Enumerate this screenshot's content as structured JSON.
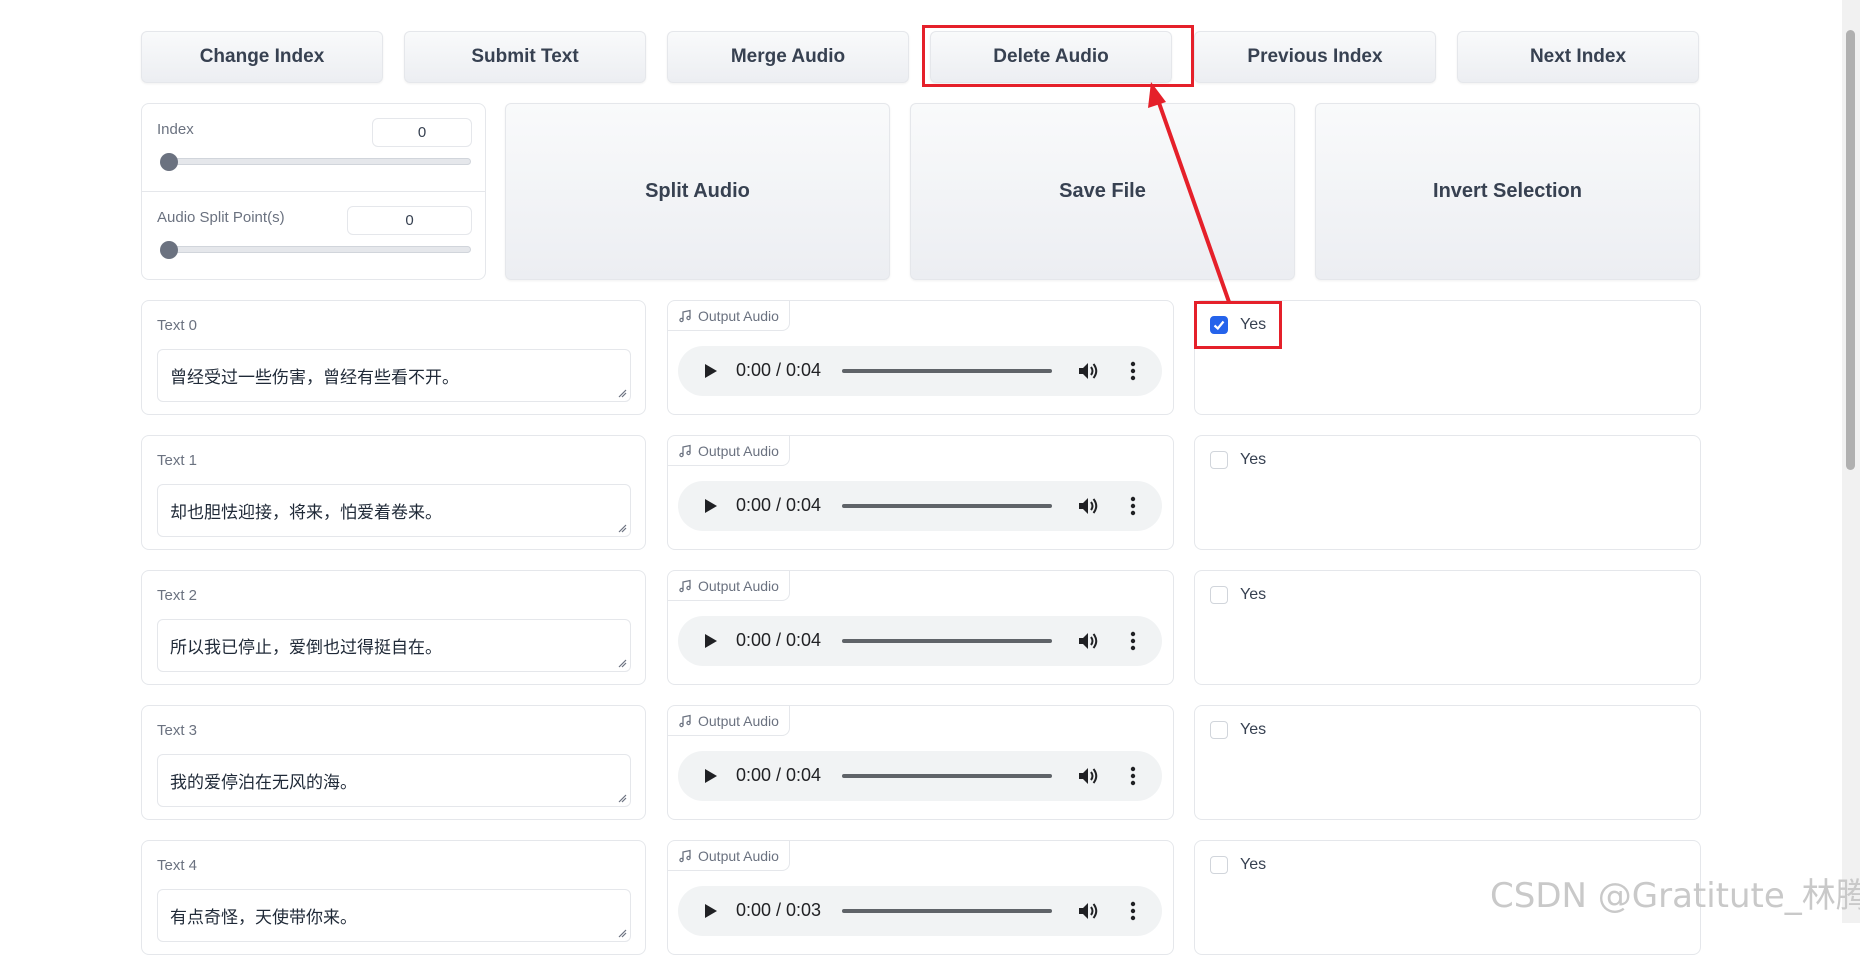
{
  "toolbar": {
    "buttons": [
      "Change Index",
      "Submit Text",
      "Merge Audio",
      "Delete Audio",
      "Previous Index",
      "Next Index"
    ]
  },
  "controls": {
    "index_label": "Index",
    "index_value": "0",
    "index_slider_fraction": 0,
    "split_label": "Audio Split Point(s)",
    "split_value": "0",
    "split_slider_fraction": 0
  },
  "actions": {
    "buttons": [
      "Split Audio",
      "Save File",
      "Invert Selection"
    ]
  },
  "rows": [
    {
      "label": "Text 0",
      "text": "曾经受过一些伤害，曾经有些看不开。",
      "audio_label": "Output Audio",
      "time": "0:00 / 0:04",
      "checkbox_label": "Yes",
      "checked": true
    },
    {
      "label": "Text 1",
      "text": "却也胆怯迎接，将来，怕爱着卷来。",
      "audio_label": "Output Audio",
      "time": "0:00 / 0:04",
      "checkbox_label": "Yes",
      "checked": false
    },
    {
      "label": "Text 2",
      "text": "所以我已停止，爱倒也过得挺自在。",
      "audio_label": "Output Audio",
      "time": "0:00 / 0:04",
      "checkbox_label": "Yes",
      "checked": false
    },
    {
      "label": "Text 3",
      "text": "我的爱停泊在无风的海。",
      "audio_label": "Output Audio",
      "time": "0:00 / 0:04",
      "checkbox_label": "Yes",
      "checked": false
    },
    {
      "label": "Text 4",
      "text": "有点奇怪，天使带你来。",
      "audio_label": "Output Audio",
      "time": "0:00 / 0:03",
      "checkbox_label": "Yes",
      "checked": false
    }
  ],
  "watermark": "CSDN @Gratitute_林腾",
  "colors": {
    "accent": "#2563eb",
    "highlight": "#e5202a"
  }
}
